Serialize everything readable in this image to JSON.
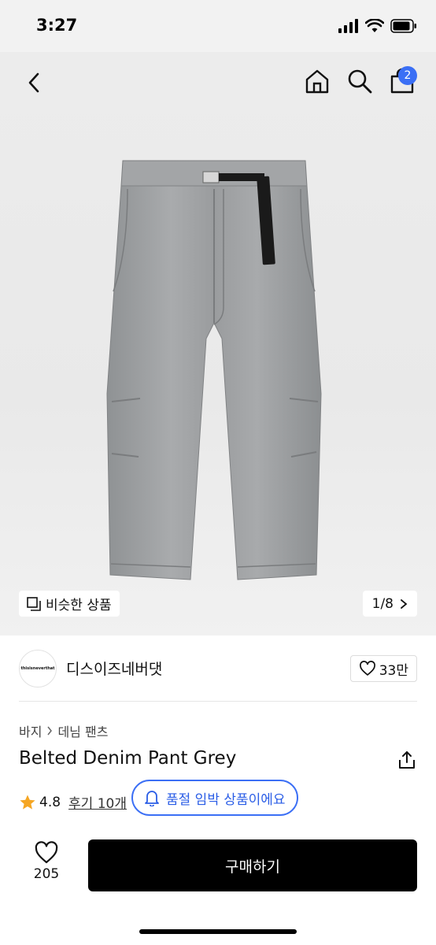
{
  "status_bar": {
    "time": "3:27"
  },
  "nav": {
    "back_icon": "chevron-left-icon",
    "home_icon": "home-icon",
    "search_icon": "search-icon",
    "cart_icon": "shopping-bag-icon",
    "cart_count": "2",
    "badge_color": "#3b6ff5"
  },
  "hero": {
    "similar_label": "비슷한 상품",
    "pager": "1/8"
  },
  "brand": {
    "logo_text": "thisisneverthat",
    "name": "디스이즈네버댓",
    "likes": "33만"
  },
  "product": {
    "breadcrumb": [
      "바지",
      "데님 팬츠"
    ],
    "title": "Belted Denim Pant Grey",
    "rating": "4.8",
    "reviews": "후기 10개",
    "soldout_notice": "품절 임박 상품이에요",
    "accent_color": "#3b6ff5",
    "star_color": "#f5a623"
  },
  "bottom_bar": {
    "wish_count": "205",
    "buy_label": "구매하기"
  }
}
